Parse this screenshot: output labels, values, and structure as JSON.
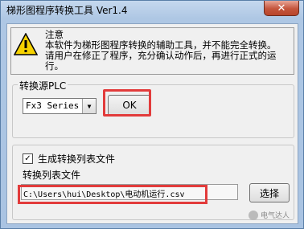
{
  "window": {
    "title": "梯形图程序转换工具 Ver1.4",
    "close_symbol": "✕"
  },
  "notice": {
    "icon": "warning-icon",
    "heading": "注意",
    "line1": "本软件为梯形图程序转换的辅助工具，并不能完全转换。",
    "line2": "请用户在修正了程序，充分确认动作后，再进行正式的运行。"
  },
  "source_group": {
    "caption": "转换源PLC",
    "selected_plc": "Fx3 Series",
    "ok_label": "OK"
  },
  "list_group": {
    "generate_label": "生成转换列表文件",
    "generate_checked": true,
    "file_label": "转换列表文件",
    "file_path": "C:\\Users\\hui\\Desktop\\电动机运行.csv",
    "browse_label": "选择"
  },
  "watermark": {
    "text": "电气达人"
  },
  "colors": {
    "highlight": "#e23b3b",
    "warning_yellow": "#f6d200"
  }
}
